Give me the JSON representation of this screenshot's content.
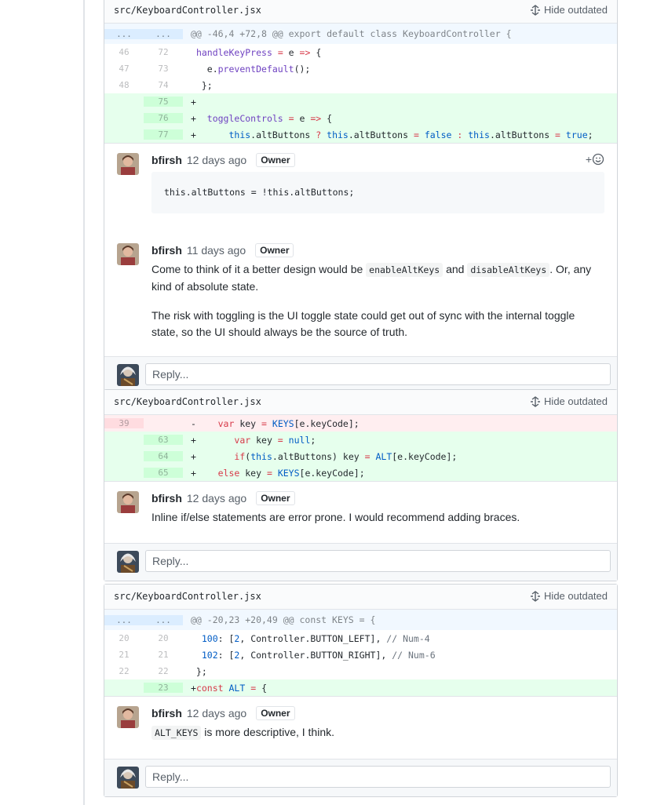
{
  "threads": [
    {
      "file_path": "src/KeyboardController.jsx",
      "hide_label": "Hide outdated",
      "hunk": "@@ -46,4 +72,8 @@ export default class KeyboardController {",
      "lines": [
        {
          "old": "46",
          "new": "72",
          "text": "  handleKeyPress = e => {"
        },
        {
          "old": "47",
          "new": "73",
          "text": "    e.preventDefault();"
        },
        {
          "old": "48",
          "new": "74",
          "text": "  };"
        },
        {
          "old": "",
          "new": "75",
          "text": "+"
        },
        {
          "old": "",
          "new": "76",
          "text": "+  toggleControls = e => {"
        },
        {
          "old": "",
          "new": "77",
          "text": "+      this.altButtons ? this.altButtons = false : this.altButtons = true;"
        }
      ],
      "comments": [
        {
          "author": "bfirsh",
          "time": "12 days ago",
          "badge": "Owner",
          "reaction": "+",
          "code": "this.altButtons = !this.altButtons;"
        },
        {
          "author": "bfirsh",
          "time": "11 days ago",
          "badge": "Owner",
          "p1a": "Come to think of it a better design would be ",
          "p1code1": "enableAltKeys",
          "p1b": " and ",
          "p1code2": "disableAltKeys",
          "p1c": ". Or, any kind of absolute state.",
          "p2": "The risk with toggling is the UI toggle state could get out of sync with the internal toggle state, so the UI should always be the source of truth."
        }
      ],
      "reply_placeholder": "Reply..."
    },
    {
      "file_path": "src/KeyboardController.jsx",
      "hide_label": "Hide outdated",
      "lines": [
        {
          "old": "39",
          "new": "",
          "text": "-    var key = KEYS[e.keyCode];"
        },
        {
          "old": "",
          "new": "63",
          "text": "+       var key = null;"
        },
        {
          "old": "",
          "new": "64",
          "text": "+       if(this.altButtons) key = ALT[e.keyCode];"
        },
        {
          "old": "",
          "new": "65",
          "text": "+    else key = KEYS[e.keyCode];"
        }
      ],
      "comments": [
        {
          "author": "bfirsh",
          "time": "12 days ago",
          "badge": "Owner",
          "text": "Inline if/else statements are error prone. I would recommend adding braces."
        }
      ],
      "reply_placeholder": "Reply..."
    },
    {
      "file_path": "src/KeyboardController.jsx",
      "hide_label": "Hide outdated",
      "hunk": "@@ -20,23 +20,49 @@ const KEYS = {",
      "lines": [
        {
          "old": "20",
          "new": "20",
          "text": "  100: [2, Controller.BUTTON_LEFT], // Num-4"
        },
        {
          "old": "21",
          "new": "21",
          "text": "  102: [2, Controller.BUTTON_RIGHT], // Num-6"
        },
        {
          "old": "22",
          "new": "22",
          "text": " };"
        },
        {
          "old": "",
          "new": "23",
          "text": "+const ALT = {"
        }
      ],
      "comments": [
        {
          "author": "bfirsh",
          "time": "12 days ago",
          "badge": "Owner",
          "code": "ALT_KEYS",
          "text": " is more descriptive, I think."
        }
      ],
      "reply_placeholder": "Reply..."
    }
  ],
  "hunk_ellipsis": "..."
}
